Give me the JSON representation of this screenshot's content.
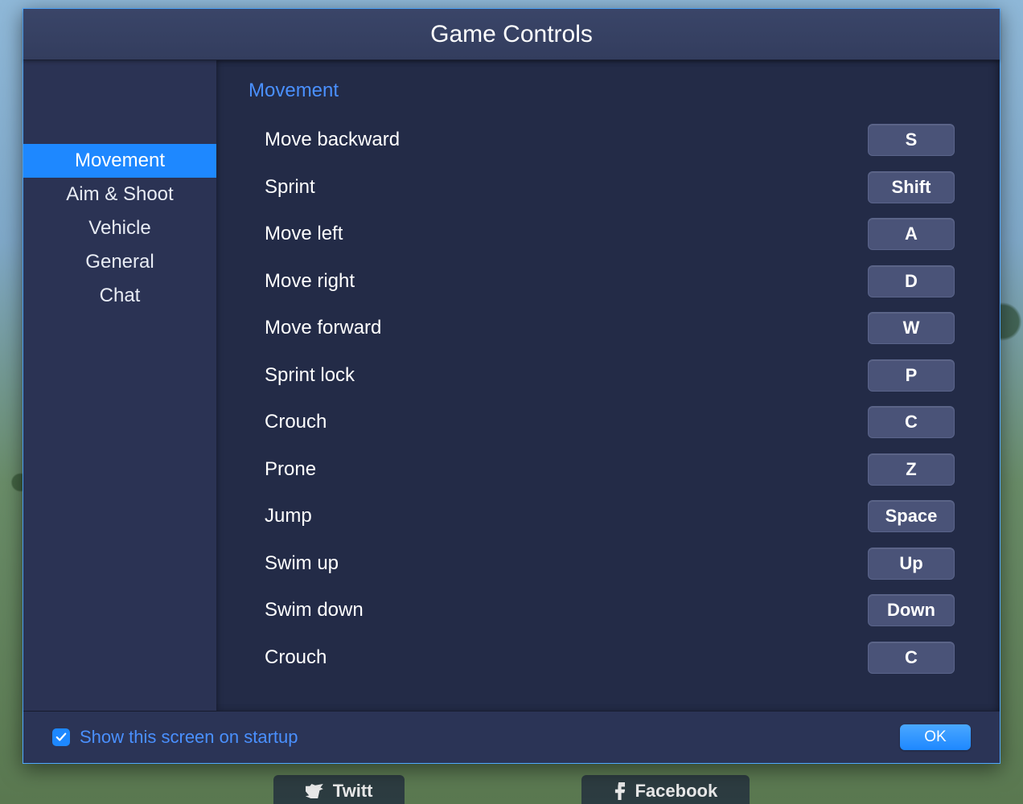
{
  "title": "Game Controls",
  "sidebar": {
    "items": [
      {
        "label": "Movement",
        "active": true
      },
      {
        "label": "Aim & Shoot",
        "active": false
      },
      {
        "label": "Vehicle",
        "active": false
      },
      {
        "label": "General",
        "active": false
      },
      {
        "label": "Chat",
        "active": false
      }
    ]
  },
  "section": {
    "title": "Movement",
    "bindings": [
      {
        "label": "Move backward",
        "key": "S"
      },
      {
        "label": "Sprint",
        "key": "Shift"
      },
      {
        "label": "Move left",
        "key": "A"
      },
      {
        "label": "Move right",
        "key": "D"
      },
      {
        "label": "Move forward",
        "key": "W"
      },
      {
        "label": "Sprint lock",
        "key": "P"
      },
      {
        "label": "Crouch",
        "key": "C"
      },
      {
        "label": "Prone",
        "key": "Z"
      },
      {
        "label": "Jump",
        "key": "Space"
      },
      {
        "label": "Swim up",
        "key": "Up"
      },
      {
        "label": "Swim down",
        "key": "Down"
      },
      {
        "label": "Crouch",
        "key": "C"
      }
    ]
  },
  "footer": {
    "startup_label": "Show this screen on startup",
    "startup_checked": true,
    "ok_label": "OK"
  },
  "background_social": {
    "left_label": "Twitt",
    "right_label": "Facebook"
  }
}
